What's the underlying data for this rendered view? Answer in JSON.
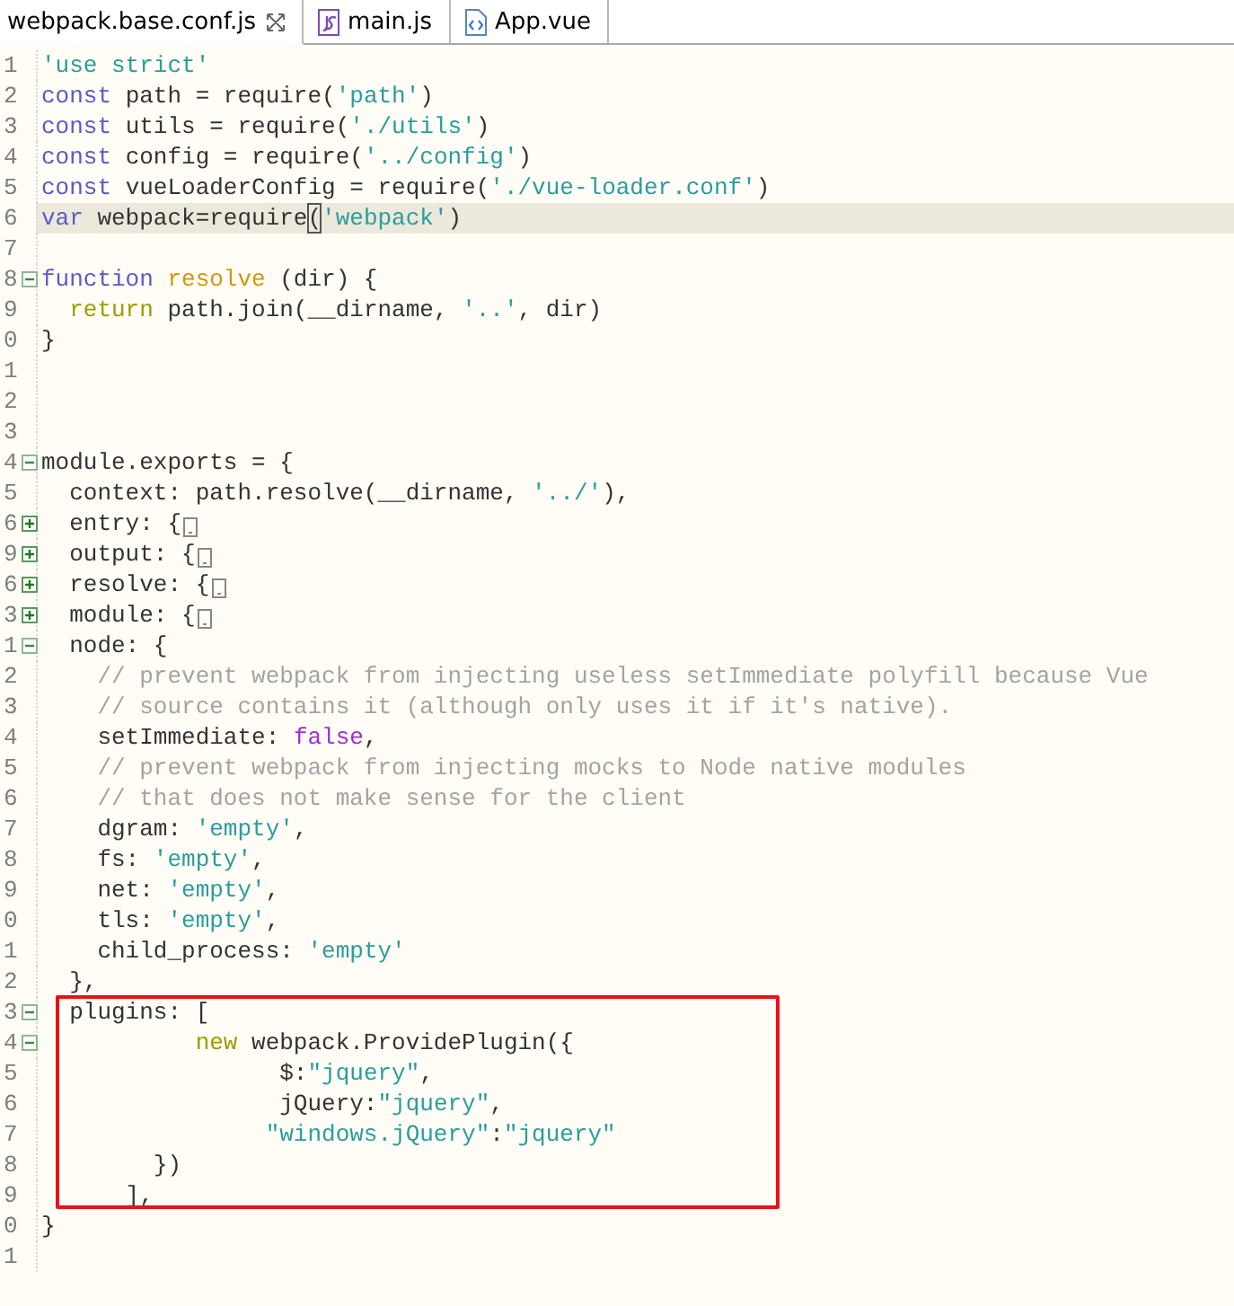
{
  "tabs": [
    {
      "label": "webpack.base.conf.js",
      "kind": "js-config",
      "selected": true
    },
    {
      "label": "main.js",
      "kind": "js",
      "selected": false
    },
    {
      "label": "App.vue",
      "kind": "vue",
      "selected": false
    }
  ],
  "lines": [
    {
      "number": "1",
      "current": false,
      "boxed": false,
      "tokens": [
        {
          "kind": "string",
          "text": "'use strict'"
        }
      ]
    },
    {
      "number": "2",
      "current": false,
      "boxed": false,
      "tokens": [
        {
          "kind": "keyword",
          "text": "const"
        },
        {
          "kind": "plain",
          "text": " path = require("
        },
        {
          "kind": "string",
          "text": "'path'"
        },
        {
          "kind": "plain",
          "text": ")"
        }
      ]
    },
    {
      "number": "3",
      "current": false,
      "boxed": false,
      "tokens": [
        {
          "kind": "keyword",
          "text": "const"
        },
        {
          "kind": "plain",
          "text": " utils = require("
        },
        {
          "kind": "string",
          "text": "'./utils'"
        },
        {
          "kind": "plain",
          "text": ")"
        }
      ]
    },
    {
      "number": "4",
      "current": false,
      "boxed": false,
      "tokens": [
        {
          "kind": "keyword",
          "text": "const"
        },
        {
          "kind": "plain",
          "text": " config = require("
        },
        {
          "kind": "string",
          "text": "'../config'"
        },
        {
          "kind": "plain",
          "text": ")"
        }
      ]
    },
    {
      "number": "5",
      "current": false,
      "boxed": false,
      "tokens": [
        {
          "kind": "keyword",
          "text": "const"
        },
        {
          "kind": "plain",
          "text": " vueLoaderConfig = require("
        },
        {
          "kind": "string",
          "text": "'./vue-loader.conf'"
        },
        {
          "kind": "plain",
          "text": ")"
        }
      ]
    },
    {
      "number": "6",
      "current": true,
      "boxed": false,
      "tokens": [
        {
          "kind": "keyword",
          "text": "var"
        },
        {
          "kind": "plain",
          "text": " webpack=require"
        },
        {
          "kind": "match",
          "text": "("
        },
        {
          "kind": "string",
          "text": "'webpack'"
        },
        {
          "kind": "plain",
          "text": ")"
        }
      ]
    },
    {
      "number": "7",
      "current": false,
      "boxed": false
    },
    {
      "number": "8",
      "expanded": true,
      "current": false,
      "boxed": false,
      "tokens": [
        {
          "kind": "keyword",
          "text": "function "
        },
        {
          "kind": "function",
          "text": "resolve"
        },
        {
          "kind": "plain",
          "text": " (dir) {"
        }
      ]
    },
    {
      "number": "9",
      "current": false,
      "boxed": false,
      "tokens": [
        {
          "kind": "control",
          "text": "  return"
        },
        {
          "kind": "plain",
          "text": " path.join(__dirname, "
        },
        {
          "kind": "string",
          "text": "'..'"
        },
        {
          "kind": "plain",
          "text": ", dir)"
        }
      ]
    },
    {
      "number": "0",
      "current": false,
      "boxed": false,
      "tokens": [
        {
          "kind": "plain",
          "text": "}"
        }
      ]
    },
    {
      "number": "1",
      "current": false,
      "boxed": false
    },
    {
      "number": "2",
      "current": false,
      "boxed": false
    },
    {
      "number": "3",
      "current": false,
      "boxed": false
    },
    {
      "number": "4",
      "expanded": true,
      "current": false,
      "boxed": false,
      "tokens": [
        {
          "kind": "plain",
          "text": "module.exports = {"
        }
      ]
    },
    {
      "number": "5",
      "current": false,
      "boxed": false,
      "tokens": [
        {
          "kind": "plain",
          "text": "  context: path.resolve(__dirname, "
        },
        {
          "kind": "string",
          "text": "'../'"
        },
        {
          "kind": "plain",
          "text": "),"
        }
      ]
    },
    {
      "number": "6",
      "expanded": false,
      "current": false,
      "boxed": false,
      "tokens": [
        {
          "kind": "plain",
          "text": "  entry: {"
        }
      ]
    },
    {
      "number": "9",
      "expanded": false,
      "current": false,
      "boxed": false,
      "tokens": [
        {
          "kind": "plain",
          "text": "  output: {"
        }
      ]
    },
    {
      "number": "6",
      "expanded": false,
      "current": false,
      "boxed": false,
      "tokens": [
        {
          "kind": "plain",
          "text": "  resolve: {"
        }
      ]
    },
    {
      "number": "3",
      "expanded": false,
      "current": false,
      "boxed": false,
      "tokens": [
        {
          "kind": "plain",
          "text": "  module: {"
        }
      ]
    },
    {
      "number": "1",
      "expanded": true,
      "current": false,
      "boxed": false,
      "tokens": [
        {
          "kind": "plain",
          "text": "  node: {"
        }
      ]
    },
    {
      "number": "2",
      "current": false,
      "boxed": false,
      "tokens": [
        {
          "kind": "comment",
          "text": "    // prevent webpack from injecting useless setImmediate polyfill because Vue"
        }
      ]
    },
    {
      "number": "3",
      "current": false,
      "boxed": false,
      "tokens": [
        {
          "kind": "comment",
          "text": "    // source contains it (although only uses it if it's native)."
        }
      ]
    },
    {
      "number": "4",
      "current": false,
      "boxed": false,
      "tokens": [
        {
          "kind": "plain",
          "text": "    setImmediate: "
        },
        {
          "kind": "literal",
          "text": "false"
        },
        {
          "kind": "plain",
          "text": ","
        }
      ]
    },
    {
      "number": "5",
      "current": false,
      "boxed": false,
      "tokens": [
        {
          "kind": "comment",
          "text": "    // prevent webpack from injecting mocks to Node native modules"
        }
      ]
    },
    {
      "number": "6",
      "current": false,
      "boxed": false,
      "tokens": [
        {
          "kind": "comment",
          "text": "    // that does not make sense for the client"
        }
      ]
    },
    {
      "number": "7",
      "current": false,
      "boxed": false,
      "tokens": [
        {
          "kind": "plain",
          "text": "    dgram: "
        },
        {
          "kind": "string",
          "text": "'empty'"
        },
        {
          "kind": "plain",
          "text": ","
        }
      ]
    },
    {
      "number": "8",
      "current": false,
      "boxed": false,
      "tokens": [
        {
          "kind": "plain",
          "text": "    fs: "
        },
        {
          "kind": "string",
          "text": "'empty'"
        },
        {
          "kind": "plain",
          "text": ","
        }
      ]
    },
    {
      "number": "9",
      "current": false,
      "boxed": false,
      "tokens": [
        {
          "kind": "plain",
          "text": "    net: "
        },
        {
          "kind": "string",
          "text": "'empty'"
        },
        {
          "kind": "plain",
          "text": ","
        }
      ]
    },
    {
      "number": "0",
      "current": false,
      "boxed": false,
      "tokens": [
        {
          "kind": "plain",
          "text": "    tls: "
        },
        {
          "kind": "string",
          "text": "'empty'"
        },
        {
          "kind": "plain",
          "text": ","
        }
      ]
    },
    {
      "number": "1",
      "current": false,
      "boxed": false,
      "tokens": [
        {
          "kind": "plain",
          "text": "    child_process: "
        },
        {
          "kind": "string",
          "text": "'empty'"
        }
      ]
    },
    {
      "number": "2",
      "current": false,
      "boxed": false,
      "tokens": [
        {
          "kind": "plain",
          "text": "  },"
        }
      ]
    },
    {
      "number": "3",
      "expanded": true,
      "current": false,
      "boxed": true,
      "tokens": [
        {
          "kind": "plain",
          "text": "  plugins: ["
        }
      ]
    },
    {
      "number": "4",
      "expanded": true,
      "current": false,
      "boxed": true,
      "tokens": [
        {
          "kind": "control",
          "text": "           new"
        },
        {
          "kind": "plain",
          "text": " webpack.ProvidePlugin({"
        }
      ]
    },
    {
      "number": "5",
      "current": false,
      "boxed": true,
      "tokens": [
        {
          "kind": "plain",
          "text": "                 $:"
        },
        {
          "kind": "string",
          "text": "\"jquery\""
        },
        {
          "kind": "plain",
          "text": ","
        }
      ]
    },
    {
      "number": "6",
      "current": false,
      "boxed": true,
      "tokens": [
        {
          "kind": "plain",
          "text": "                 jQuery:"
        },
        {
          "kind": "string",
          "text": "\"jquery\""
        },
        {
          "kind": "plain",
          "text": ","
        }
      ]
    },
    {
      "number": "7",
      "current": false,
      "boxed": true,
      "tokens": [
        {
          "kind": "string",
          "text": "                \"windows.jQuery\""
        },
        {
          "kind": "plain",
          "text": ":"
        },
        {
          "kind": "string",
          "text": "\"jquery\""
        }
      ]
    },
    {
      "number": "8",
      "current": false,
      "boxed": true,
      "tokens": [
        {
          "kind": "plain",
          "text": "        })"
        }
      ]
    },
    {
      "number": "9",
      "current": false,
      "boxed": true,
      "tokens": [
        {
          "kind": "plain",
          "text": "      ],"
        }
      ]
    },
    {
      "number": "0",
      "current": false,
      "boxed": false,
      "tokens": [
        {
          "kind": "plain",
          "text": "}"
        }
      ]
    },
    {
      "number": "1",
      "current": false,
      "boxed": false
    }
  ]
}
